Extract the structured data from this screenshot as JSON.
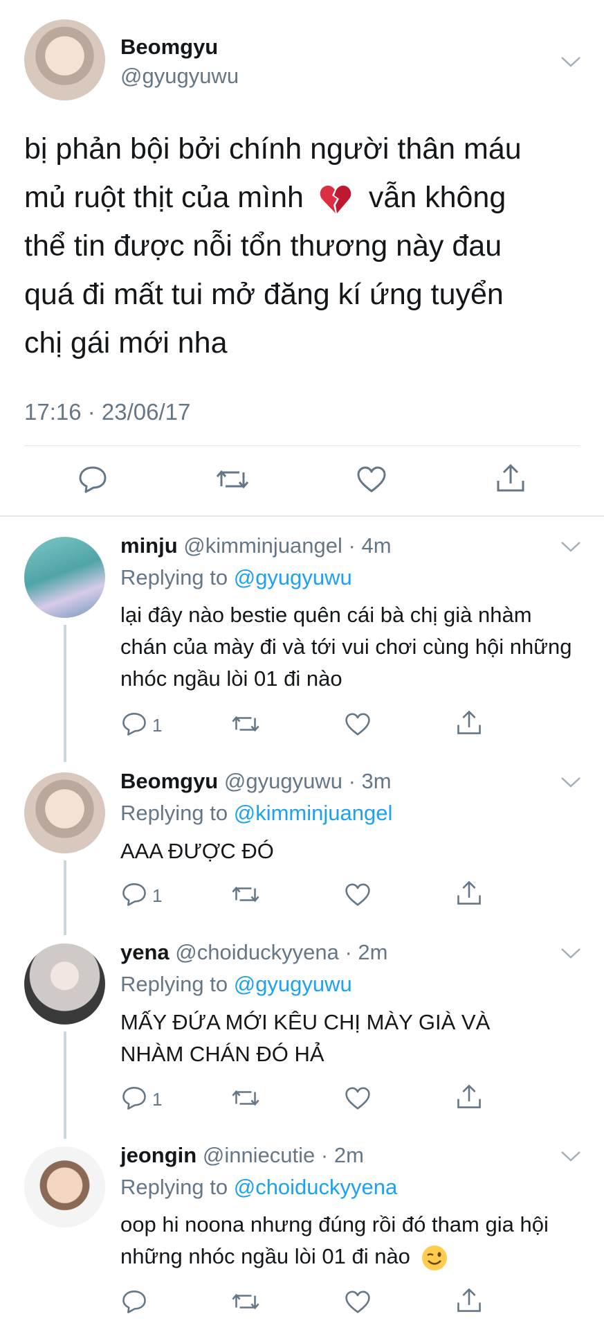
{
  "main_tweet": {
    "name": "Beomgyu",
    "handle": "@gyugyuwu",
    "text_line1": "bị phản bội bởi chính người thân máu",
    "text_line2a": "mủ ruột thịt của mình",
    "text_line2_emoji": "broken-heart",
    "text_line2b": "vẫn không",
    "text_line3": "thể tin được nỗi tổn thương này đau",
    "text_line4": "quá đi mất tui mở đăng kí ứng tuyển",
    "text_line5": "chị gái mới nha",
    "timestamp": "17:16 · 23/06/17"
  },
  "replies": [
    {
      "name": "minju",
      "handle": "@kimminjuangel",
      "time": "· 4m",
      "replying_label": "Replying to",
      "replying_to": "@gyugyuwu",
      "text": "lại đây nào bestie quên cái bà chị già nhàm chán của mày đi và tới vui chơi cùng hội những nhóc ngầu lòi 01 đi nào",
      "reply_count": "1"
    },
    {
      "name": "Beomgyu",
      "handle": "@gyugyuwu",
      "time": "· 3m",
      "replying_label": "Replying to",
      "replying_to": "@kimminjuangel",
      "text": "AAA ĐƯỢC ĐÓ",
      "reply_count": "1"
    },
    {
      "name": "yena",
      "handle": "@choiduckyyena",
      "time": "· 2m",
      "replying_label": "Replying to",
      "replying_to": "@gyugyuwu",
      "text": "MẤY ĐỨA MỚI KÊU CHỊ MÀY GIÀ VÀ NHÀM CHÁN ĐÓ HẢ",
      "reply_count": "1"
    },
    {
      "name": "jeongin",
      "handle": "@inniecutie",
      "time": "· 2m",
      "replying_label": "Replying to",
      "replying_to": "@choiduckyyena",
      "text": "oop hi noona nhưng đúng rồi đó tham gia hội những nhóc ngầu lòi 01 đi nào",
      "text_emoji": "winking-face",
      "reply_count": ""
    }
  ],
  "colors": {
    "link": "#1da1f2",
    "secondary_text": "#657786",
    "divider": "#e1e8ed",
    "thread_line": "#ccd6dd",
    "icon": "#657786"
  }
}
